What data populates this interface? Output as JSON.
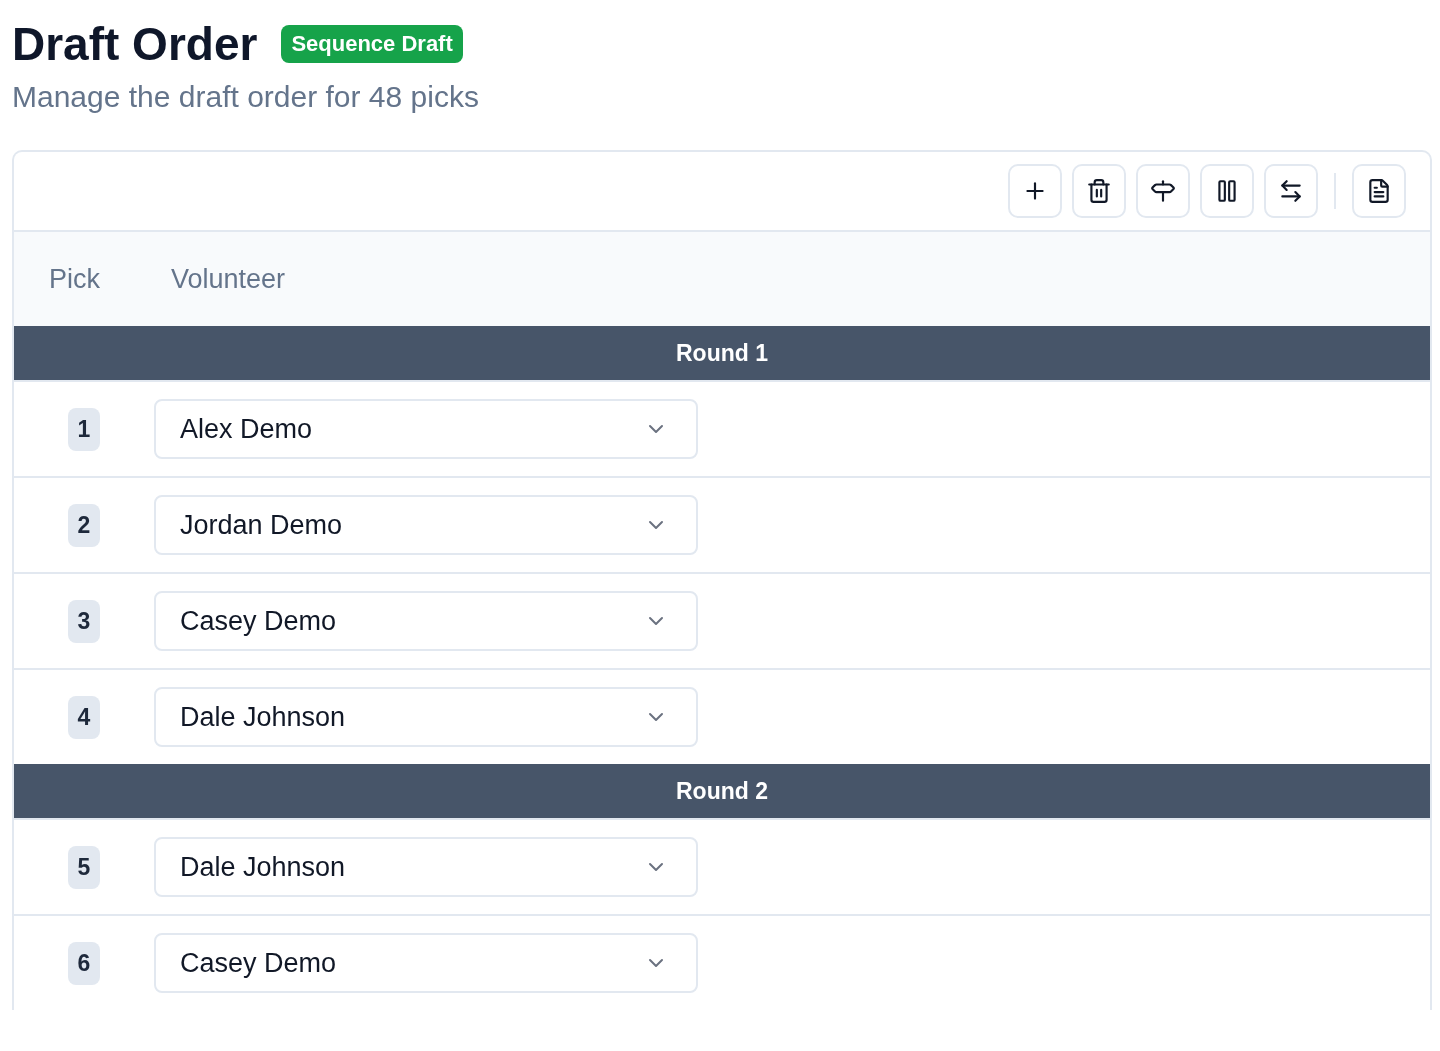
{
  "header": {
    "title": "Draft Order",
    "badge": "Sequence Draft",
    "subtitle": "Manage the draft order for 48 picks"
  },
  "toolbar": {
    "buttons": [
      {
        "kind": "add"
      },
      {
        "kind": "delete"
      },
      {
        "kind": "signpost"
      },
      {
        "kind": "pause"
      },
      {
        "kind": "swap"
      },
      {
        "kind": "divider"
      },
      {
        "kind": "document"
      }
    ]
  },
  "table": {
    "columns": [
      "Pick",
      "Volunteer"
    ],
    "rounds": [
      {
        "title": "Round 1",
        "picks": [
          {
            "pick": "1",
            "volunteer": "Alex Demo"
          },
          {
            "pick": "2",
            "volunteer": "Jordan Demo"
          },
          {
            "pick": "3",
            "volunteer": "Casey Demo"
          },
          {
            "pick": "4",
            "volunteer": "Dale Johnson"
          }
        ]
      },
      {
        "title": "Round 2",
        "picks": [
          {
            "pick": "5",
            "volunteer": "Dale Johnson"
          },
          {
            "pick": "6",
            "volunteer": "Casey Demo"
          }
        ]
      }
    ]
  }
}
